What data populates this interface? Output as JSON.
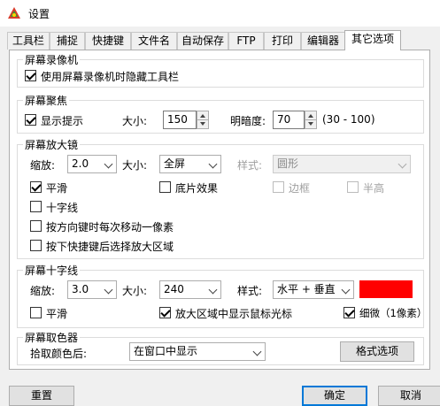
{
  "window": {
    "title": "设置"
  },
  "tabs": [
    "工具栏",
    "捕捉",
    "快捷键",
    "文件名",
    "自动保存",
    "FTP",
    "打印",
    "编辑器",
    "其它选项"
  ],
  "screen_recorder": {
    "title": "屏幕录像机",
    "hide_toolbar_label": "使用屏幕录像机时隐藏工具栏"
  },
  "screen_focus": {
    "title": "屏幕聚焦",
    "show_hint_label": "显示提示",
    "size_label": "大小:",
    "size_value": "150",
    "brightness_label": "明暗度:",
    "brightness_value": "70",
    "brightness_range": "(30 - 100)"
  },
  "magnifier": {
    "title": "屏幕放大镜",
    "zoom_label": "缩放:",
    "zoom_value": "2.0",
    "size_label": "大小:",
    "size_value": "全屏",
    "style_label": "样式:",
    "style_value": "圆形",
    "smooth_label": "平滑",
    "negative_label": "底片效果",
    "border_label": "边框",
    "halftone_label": "半高",
    "crosshair_label": "十字线",
    "arrow_move_label": "按方向键时每次移动一像素",
    "hotkey_select_label": "按下快捷键后选择放大区域"
  },
  "crosshair": {
    "title": "屏幕十字线",
    "zoom_label": "缩放:",
    "zoom_value": "3.0",
    "size_label": "大小:",
    "size_value": "240",
    "style_label": "样式:",
    "style_value": "水平 + 垂直",
    "color": "#ff0000",
    "smooth_label": "平滑",
    "show_cursor_label": "放大区域中显示鼠标光标",
    "thin_label": "细微（1像素）"
  },
  "color_picker": {
    "title": "屏幕取色器",
    "after_pick_label": "拾取颜色后:",
    "after_pick_value": "在窗口中显示",
    "format_button": "格式选项"
  },
  "footer": {
    "reset": "重置",
    "ok": "确定",
    "cancel": "取消"
  }
}
